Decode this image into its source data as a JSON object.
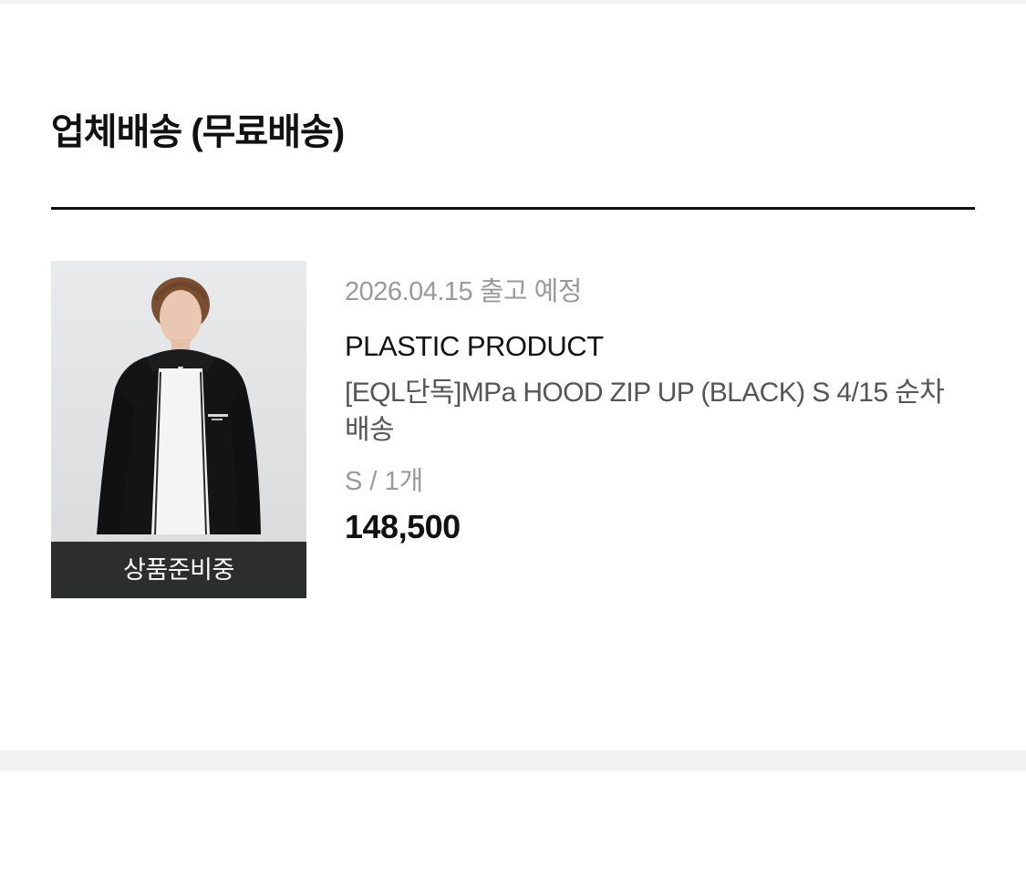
{
  "section": {
    "title": "업체배송 (무료배송)"
  },
  "order_item": {
    "status_badge": "상품준비중",
    "ship_date": "2026.04.15 출고 예정",
    "brand": "PLASTIC PRODUCT",
    "product_name": "[EQL단독]MPa HOOD ZIP UP (BLACK) S 4/15 순차배송",
    "option": "S / 1개",
    "price": "148,500",
    "thumbnail_icon": "product-photo-hood-zip-up-black"
  },
  "colors": {
    "text_primary": "#111111",
    "text_muted": "#9a9a9a",
    "badge_bg": "#1f1f1f",
    "divider": "#111111"
  }
}
